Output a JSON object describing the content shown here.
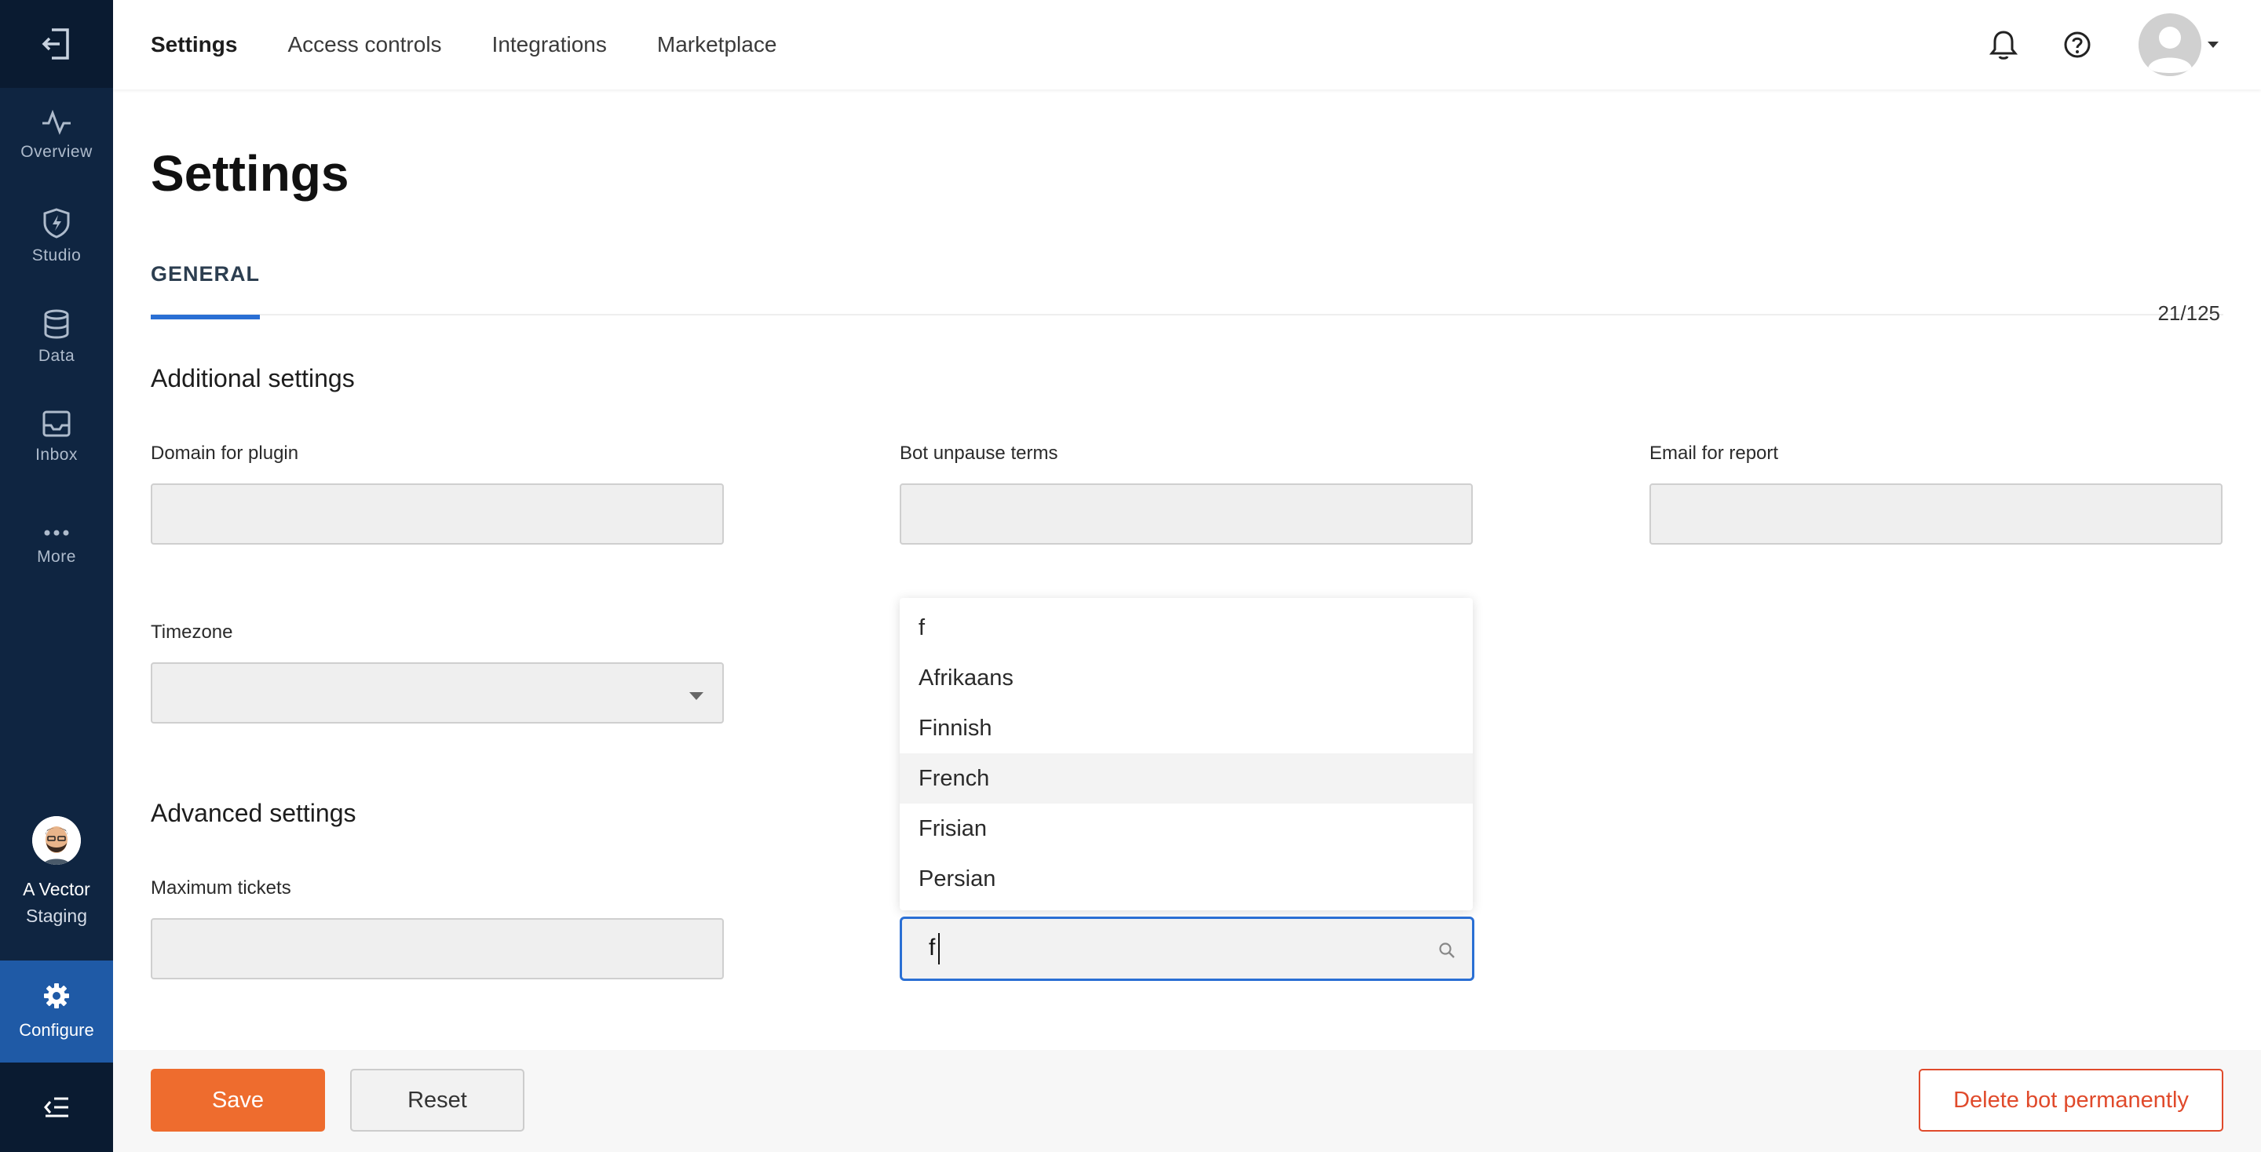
{
  "sidebar": {
    "items": [
      {
        "label": "Overview",
        "icon": "activity-icon"
      },
      {
        "label": "Studio",
        "icon": "shield-bolt-icon"
      },
      {
        "label": "Data",
        "icon": "database-icon"
      },
      {
        "label": "Inbox",
        "icon": "inbox-icon"
      },
      {
        "label": "More",
        "icon": "ellipsis-icon"
      }
    ],
    "profile": {
      "name": "A Vector",
      "env": "Staging"
    },
    "configure_label": "Configure"
  },
  "topnav": {
    "tabs": [
      "Settings",
      "Access controls",
      "Integrations",
      "Marketplace"
    ],
    "active_tab": "Settings"
  },
  "page": {
    "title": "Settings",
    "tab": "GENERAL",
    "counter": "21/125"
  },
  "additional": {
    "title": "Additional settings",
    "domain_label": "Domain for plugin",
    "unpause_label": "Bot unpause terms",
    "email_label": "Email for report",
    "timezone_label": "Timezone"
  },
  "advanced": {
    "title": "Advanced settings",
    "max_tickets_label": "Maximum tickets"
  },
  "language_dropdown": {
    "options": [
      "f",
      "Afrikaans",
      "Finnish",
      "French",
      "Frisian",
      "Persian"
    ],
    "highlighted": "French",
    "search_value": "f"
  },
  "footer": {
    "save": "Save",
    "reset": "Reset",
    "delete": "Delete bot permanently"
  },
  "colors": {
    "sidebar": "#0f2541",
    "accent": "#2a6fd4",
    "save": "#ee6c2e",
    "danger": "#e04a2b"
  }
}
